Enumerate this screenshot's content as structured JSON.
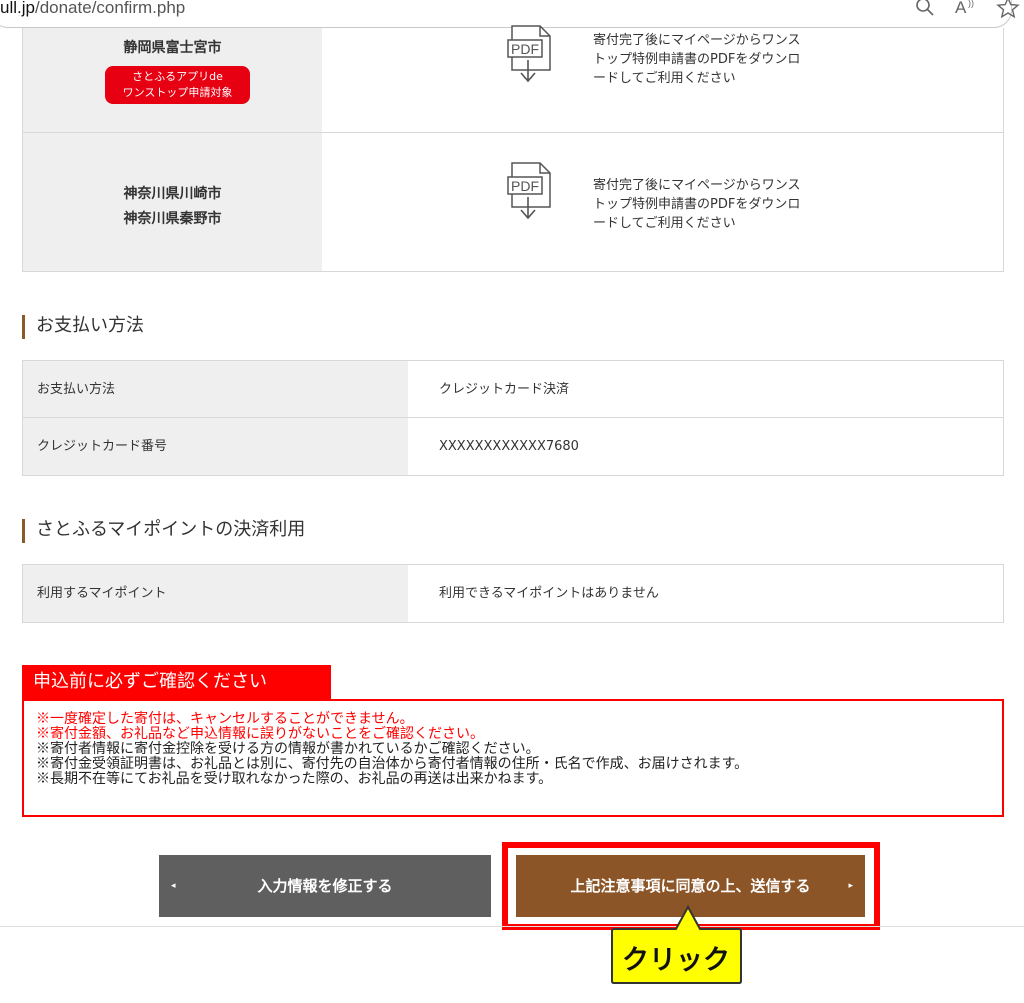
{
  "browser": {
    "url_domain": "ull.jp",
    "url_path": "/donate/confirm.php",
    "icons": [
      "search-icon",
      "read-aloud-icon",
      "favorite-star-icon"
    ]
  },
  "one_stop": {
    "rows": [
      {
        "cities": [
          "静岡県富士宮市"
        ],
        "badge": [
          "さとふるアプリde",
          "ワンストップ申請対象"
        ],
        "pdf_label": "PDF",
        "description": [
          "寄付完了後にマイページからワンス",
          "トップ特例申請書のPDFをダウンロ",
          "ードしてご利用ください"
        ]
      },
      {
        "cities": [
          "神奈川県川崎市",
          "神奈川県秦野市"
        ],
        "pdf_label": "PDF",
        "description": [
          "寄付完了後にマイページからワンス",
          "トップ特例申請書のPDFをダウンロ",
          "ードしてご利用ください"
        ]
      }
    ]
  },
  "payment": {
    "heading": "お支払い方法",
    "rows": [
      {
        "label": "お支払い方法",
        "value": "クレジットカード決済"
      },
      {
        "label": "クレジットカード番号",
        "value": "XXXXXXXXXXXX7680"
      }
    ]
  },
  "points": {
    "heading": "さとふるマイポイントの決済利用",
    "rows": [
      {
        "label": "利用するマイポイント",
        "value": "利用できるマイポイントはありません"
      }
    ]
  },
  "notice": {
    "title": "申込前に必ずご確認ください",
    "lines_red": [
      "※一度確定した寄付は、キャンセルすることができません。",
      "※寄付金額、お礼品など申込情報に誤りがないことをご確認ください。"
    ],
    "lines_black": [
      "※寄付者情報に寄付金控除を受ける方の情報が書かれているかご確認ください。",
      "※寄付金受領証明書は、お礼品とは別に、寄付先の自治体から寄付者情報の住所・氏名で作成、お届けされます。",
      "※長期不在等にてお礼品を受け取れなかった際の、お礼品の再送は出来かねます。"
    ]
  },
  "buttons": {
    "back_label": "入力情報を修正する",
    "back_arrow": "◂",
    "submit_label": "上記注意事項に同意の上、送信する",
    "submit_arrow": "▸"
  },
  "callout": {
    "text": "クリック"
  },
  "colors": {
    "accent_brown": "#8b5527",
    "notice_red": "#ff0000",
    "back_gray": "#5f5f5f",
    "callout_yellow": "#ffff00"
  }
}
